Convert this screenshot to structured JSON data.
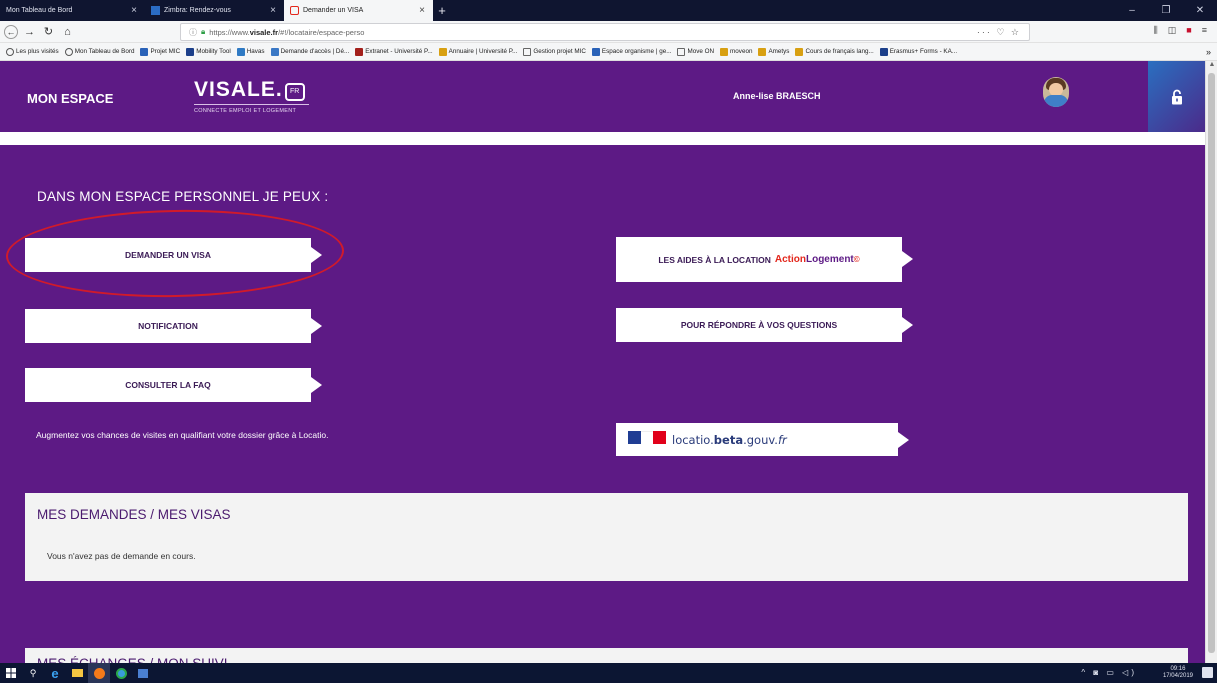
{
  "browser": {
    "tabs": [
      {
        "label": "Mon Tableau de Bord"
      },
      {
        "label": "Zimbra: Rendez-vous"
      },
      {
        "label": "Demander un VISA",
        "active": true
      }
    ],
    "new_tab_icon": "+",
    "url": "https://www.visale.fr/#!/locataire/espace-perso",
    "url_host": "https://www.",
    "url_domain": "visale.fr",
    "url_path": "/#!/locataire/espace-perso",
    "url_menu": "··· ♡ ☆",
    "bookmarks": [
      "Les plus visités",
      "Mon Tableau de Bord",
      "Projet MIC",
      "Mobility Tool",
      "Havas",
      "Demande d'accès | Dé...",
      "Extranet - Université P...",
      "Annuaire | Université P...",
      "Gestion projet MIC",
      "Espace organisme | ge...",
      "Move ON",
      "moveon",
      "Ametys",
      "Cours de français lang...",
      "Erasmus+ Forms - KA..."
    ]
  },
  "header": {
    "mon_espace": "MON ESPACE",
    "logo_word": "VISALE.",
    "logo_badge": "FR",
    "logo_tagline": "CONNECTE EMPLOI ET LOGEMENT",
    "username": "Anne-lise BRAESCH"
  },
  "main": {
    "title": "DANS MON ESPACE PERSONNEL JE PEUX :",
    "buttons": {
      "visa": "DEMANDER UN VISA",
      "notification": "NOTIFICATION",
      "faq": "CONSULTER LA FAQ",
      "aides_prefix": "LES AIDES À LA LOCATION",
      "aides_brand_a": "Action",
      "aides_brand_b": "Logement",
      "questions": "POUR RÉPONDRE À VOS QUESTIONS",
      "locatio_a": "locatio.",
      "locatio_b": "beta",
      "locatio_c": ".gouv.",
      "locatio_d": "fr"
    },
    "augmentez": "Augmentez vos chances de visites en qualifiant votre dossier grâce à Locatio.",
    "demandes_title": "MES DEMANDES / MES VISAS",
    "demandes_msg": "Vous n'avez pas de demande en cours.",
    "echanges_title": "MES ÉCHANGES / MON SUIVI"
  },
  "taskbar": {
    "time": "09:16",
    "date": "17/04/2019"
  },
  "colors": {
    "brand_purple": "#5d1a85",
    "annotation_red": "#d11a2a",
    "action_logement_red": "#e3271c"
  }
}
